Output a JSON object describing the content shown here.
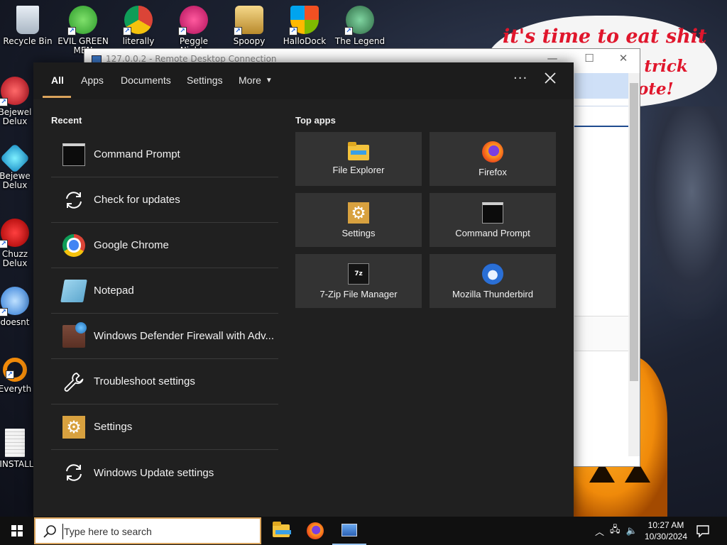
{
  "desktop": {
    "speech": {
      "line1": "it's time to eat shit",
      "line2": "o trick",
      "line3": "ote!"
    },
    "icons": [
      {
        "label": "Recycle Bin"
      },
      {
        "label": "EVIL GREEN MEN"
      },
      {
        "label": "literally"
      },
      {
        "label": "Peggle Nights"
      },
      {
        "label": "Spoopy"
      },
      {
        "label": "HalloDock"
      },
      {
        "label": "The Legend"
      },
      {
        "label": "Bejewel Delux"
      },
      {
        "label": "Bejewe Delux"
      },
      {
        "label": "Chuzz Delux"
      },
      {
        "label": "doesnt"
      },
      {
        "label": "Everyth"
      },
      {
        "label": "!INSTALL"
      }
    ]
  },
  "rdp_window": {
    "title": "127.0.0.2 - Remote Desktop Connection"
  },
  "search_menu": {
    "tabs": [
      {
        "label": "All"
      },
      {
        "label": "Apps"
      },
      {
        "label": "Documents"
      },
      {
        "label": "Settings"
      },
      {
        "label": "More"
      }
    ],
    "more_options": "···",
    "recent_title": "Recent",
    "recent": [
      {
        "label": "Command Prompt",
        "icon": "command-prompt-icon"
      },
      {
        "label": "Check for updates",
        "icon": "sync-icon"
      },
      {
        "label": "Google Chrome",
        "icon": "chrome-icon"
      },
      {
        "label": "Notepad",
        "icon": "notepad-icon"
      },
      {
        "label": "Windows Defender Firewall with Adv...",
        "icon": "firewall-icon"
      },
      {
        "label": "Troubleshoot settings",
        "icon": "wrench-icon"
      },
      {
        "label": "Settings",
        "icon": "settings-gear-icon"
      },
      {
        "label": "Windows Update settings",
        "icon": "sync-icon"
      }
    ],
    "top_apps_title": "Top apps",
    "top_apps": [
      {
        "label": "File Explorer",
        "icon": "folder-icon"
      },
      {
        "label": "Firefox",
        "icon": "firefox-icon"
      },
      {
        "label": "Settings",
        "icon": "settings-gear-icon"
      },
      {
        "label": "Command Prompt",
        "icon": "command-prompt-icon"
      },
      {
        "label": "7-Zip File Manager",
        "icon": "7zip-icon"
      },
      {
        "label": "Mozilla Thunderbird",
        "icon": "thunderbird-icon"
      }
    ]
  },
  "taskbar": {
    "search_placeholder": "Type here to search",
    "time": "10:27 AM",
    "date": "10/30/2024",
    "accent_color": "#d9a35c"
  },
  "text_7zip": "7z"
}
